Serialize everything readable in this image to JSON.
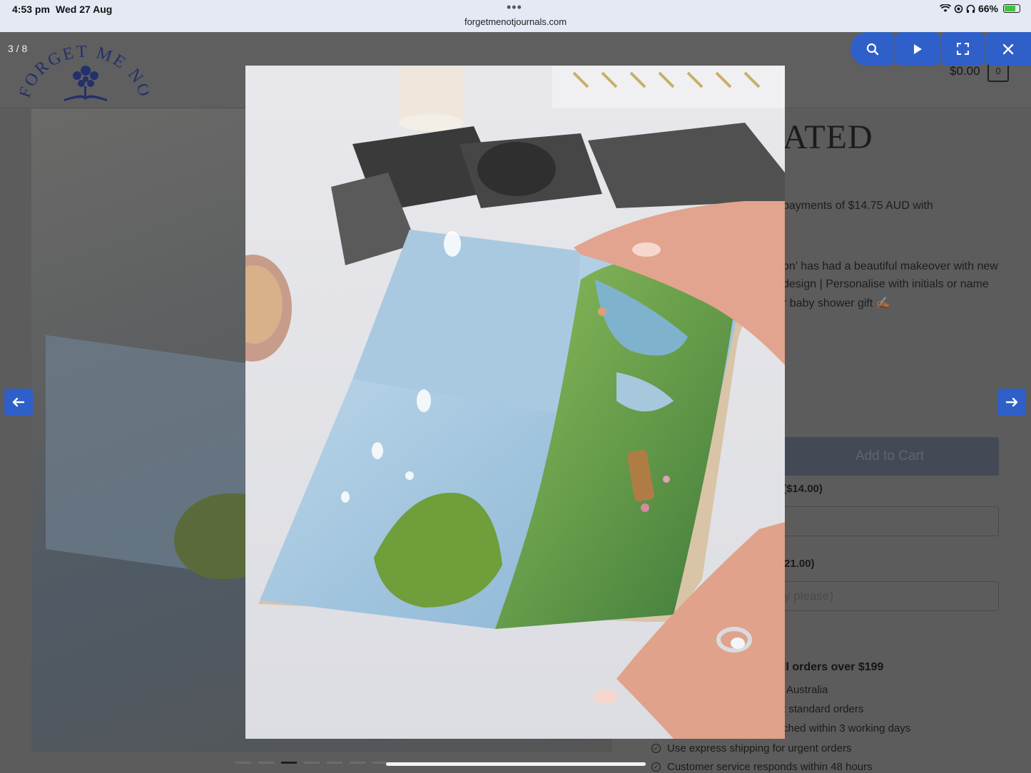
{
  "status_bar": {
    "time": "4:53 pm",
    "date": "Wed 27 Aug",
    "url": "forgetmenotjournals.com",
    "battery": "66%"
  },
  "header": {
    "logo_text": "FORGET ME NOT",
    "cart_price": "$0.00",
    "cart_count": "0"
  },
  "lightbox": {
    "counter": "3 / 8",
    "buttons": {
      "search_icon": "search-icon",
      "play_icon": "play-icon",
      "fullscreen_icon": "fullscreen-icon",
      "close_icon": "close-icon"
    }
  },
  "product": {
    "title_fragment": "ATED",
    "afterpay_line": "payments of $14.75 AUD with",
    "desc_1": "on’ has had a beautiful makeover with new",
    "desc_2": "design | Personalise with initials or name",
    "desc_3": "r baby shower gift ✍🏾",
    "add_to_cart": "Add to Cart",
    "option_1_label": "($14.00)",
    "option_2_label": "21.00)",
    "option_2_placeholder": "y please)"
  },
  "shipping": {
    "heading": "ll orders over $199",
    "lines": [
      "Australia",
      "t standard orders",
      "ched within 3 working days",
      "Use express shipping for urgent orders",
      "Customer service responds within 48 hours"
    ]
  },
  "colors": {
    "accent": "#2f5fc9",
    "status_bar_bg": "#e4e9f3",
    "overlay_bg": "#5c5c5d"
  }
}
